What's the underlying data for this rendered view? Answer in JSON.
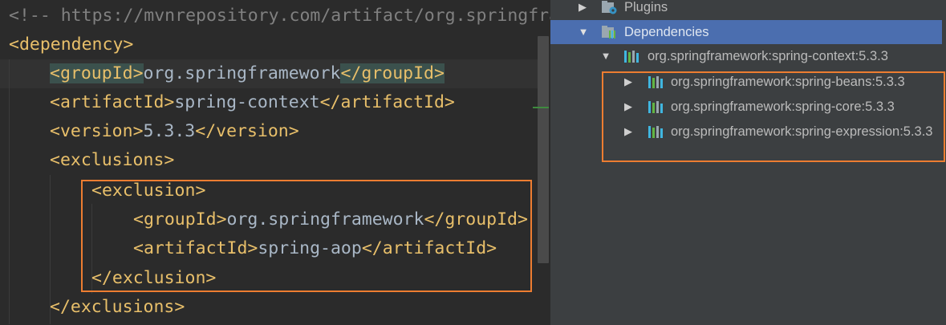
{
  "editor": {
    "lines": [
      {
        "kind": "comment",
        "prefix": "<!-- ",
        "url": "https://mvnrepository.com/artifact/org.springframework/spring-context"
      },
      {
        "kind": "open",
        "tag": "dependency"
      },
      {
        "kind": "element",
        "tag": "groupId",
        "value": "org.springframework"
      },
      {
        "kind": "element",
        "tag": "artifactId",
        "value": "spring-context"
      },
      {
        "kind": "element",
        "tag": "version",
        "value": "5.3.3"
      },
      {
        "kind": "open",
        "tag": "exclusions"
      },
      {
        "kind": "open",
        "tag": "exclusion"
      },
      {
        "kind": "element",
        "tag": "groupId",
        "value": "org.springframework"
      },
      {
        "kind": "element",
        "tag": "artifactId",
        "value": "spring-aop"
      },
      {
        "kind": "close",
        "tag": "exclusion"
      },
      {
        "kind": "close",
        "tag": "exclusions"
      }
    ],
    "colors": {
      "tag": "#e8bf6a",
      "text": "#a9b7c6",
      "comment": "#808080",
      "highlight_box": "#ed7d31"
    }
  },
  "maven": {
    "rows": [
      {
        "label": "Plugins",
        "icon": "folder-plugin-icon",
        "arrow": "right"
      },
      {
        "label": "Dependencies",
        "icon": "library-folder-icon",
        "arrow": "down",
        "selected": true
      },
      {
        "label": "org.springframework:spring-context:5.3.3",
        "icon": "library-icon",
        "arrow": "down"
      },
      {
        "label": "org.springframework:spring-beans:5.3.3",
        "icon": "library-icon",
        "arrow": "right"
      },
      {
        "label": "org.springframework:spring-core:5.3.3",
        "icon": "library-icon",
        "arrow": "right"
      },
      {
        "label": "org.springframework:spring-expression:5.3.3",
        "icon": "library-icon",
        "arrow": "right"
      }
    ],
    "colors": {
      "selected_bg": "#4b6eaf",
      "panel_bg": "#3c3f41"
    }
  }
}
